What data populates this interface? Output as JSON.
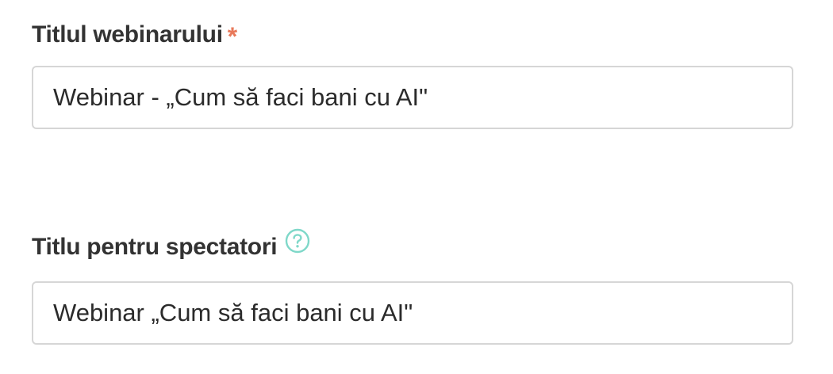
{
  "form": {
    "webinar_title": {
      "label": "Titlul webinarului",
      "required_mark": "*",
      "value": "Webinar - „Cum să faci bani cu AI\""
    },
    "viewer_title": {
      "label": "Titlu pentru spectatori",
      "help_icon": "question-circle-icon",
      "value": "Webinar „Cum să faci bani cu AI\""
    }
  },
  "colors": {
    "required": "#e8795a",
    "help_icon": "#7fd8c9",
    "label": "#333333",
    "input_border": "#d6d6d6"
  }
}
